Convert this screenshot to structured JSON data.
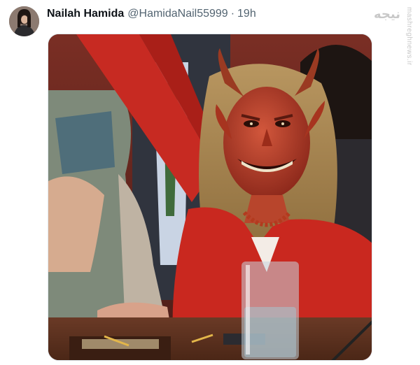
{
  "tweet": {
    "display_name": "Nailah Hamida",
    "handle": "@HamidaNail55999",
    "separator": "·",
    "timestamp": "19h",
    "avatar_icon": "user-avatar",
    "media_icon": "photo-image"
  },
  "watermark": {
    "logo_text": "نیجه",
    "site": "mashreghnews.ir"
  },
  "colors": {
    "name": "#0f1419",
    "secondary": "#536471",
    "media_border": "#e1e8ed"
  }
}
